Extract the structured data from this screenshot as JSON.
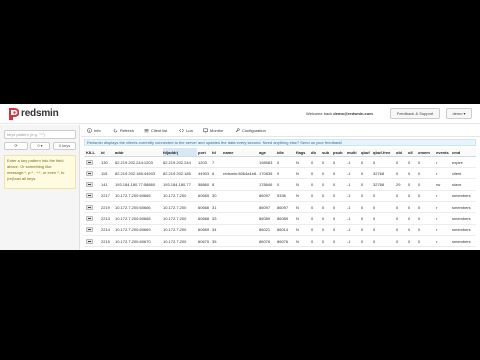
{
  "app": {
    "logo_text": "redsmin",
    "welcome_prefix": "Welcome back ",
    "welcome_email": "demo@redsmin.com",
    "feedback_label": "Feedback & Support",
    "user_label": "demo ▾"
  },
  "sidebar": {
    "search_placeholder": "keys pattern (e.g. \"*\")",
    "refresh_label": "⟳",
    "db_label": "0 ▾",
    "add_label": "0 keys",
    "hint_text": "Enter a key pattern into the field above. Or something like: message:*, p:* , *:*, or even *, to (re)load all keys."
  },
  "toolbar": {
    "items": [
      {
        "label": "Info",
        "icon": "info-icon"
      },
      {
        "label": "Refresh",
        "icon": "refresh-icon"
      },
      {
        "label": "Client list",
        "icon": "list-icon"
      },
      {
        "label": "Lua",
        "icon": "code-icon"
      },
      {
        "label": "Monitor",
        "icon": "monitor-icon"
      },
      {
        "label": "Configuration",
        "icon": "wrench-icon"
      }
    ],
    "alert": "Redsmin displays the clients currently connected to the server and updates the data every second. Need anything else? Send us your feedback!"
  },
  "table": {
    "columns": [
      "KILL",
      "id",
      "addr",
      "fd(addr)",
      "port",
      "fd",
      "name",
      "age",
      "idle",
      "flags",
      "db",
      "sub",
      "psub",
      "multi",
      "qbuf",
      "qbuf-free",
      "obl",
      "oll",
      "omem",
      "events",
      "cmd"
    ],
    "rows": [
      [
        "",
        "130",
        "82.219.202.244:1203",
        "82.219.202.244",
        "1203",
        "7",
        "",
        "198983",
        "0",
        "N",
        "0",
        "0",
        "0",
        "-1",
        "0",
        "0",
        "0",
        "0",
        "0",
        "r",
        "expire"
      ],
      [
        "",
        "115",
        "82.219.202.185:44903",
        "82.219.202.185",
        "44903",
        "6",
        "redsmin:8064a1b8...",
        "170835",
        "0",
        "N",
        "0",
        "0",
        "0",
        "-1",
        "0",
        "32768",
        "0",
        "0",
        "0",
        "r",
        "client"
      ],
      [
        "",
        "141",
        "193.184.180.77:58860",
        "193.184.180.77",
        "58860",
        "8",
        "",
        "178846",
        "0",
        "N",
        "0",
        "0",
        "0",
        "-1",
        "0",
        "32768",
        "29",
        "0",
        "0",
        "rw",
        "slave"
      ],
      [
        "",
        "2217",
        "10.172.7.200:60665",
        "10.172.7.200",
        "60665",
        "30",
        "",
        "86097",
        "5336",
        "N",
        "0",
        "0",
        "0",
        "-1",
        "0",
        "0",
        "0",
        "0",
        "0",
        "r",
        "smembers"
      ],
      [
        "",
        "2219",
        "10.172.7.200:60666",
        "10.172.7.200",
        "60666",
        "31",
        "",
        "86097",
        "86097",
        "N",
        "0",
        "0",
        "0",
        "-1",
        "0",
        "0",
        "0",
        "0",
        "0",
        "r",
        "smembers"
      ],
      [
        "",
        "2213",
        "10.172.7.200:60668",
        "10.172.7.200",
        "60668",
        "33",
        "",
        "86089",
        "86089",
        "N",
        "0",
        "0",
        "0",
        "-1",
        "0",
        "0",
        "0",
        "0",
        "0",
        "r",
        "smembers"
      ],
      [
        "",
        "2214",
        "10.172.7.200:60669",
        "10.172.7.200",
        "60669",
        "34",
        "",
        "86021",
        "86014",
        "N",
        "0",
        "0",
        "0",
        "-1",
        "0",
        "0",
        "0",
        "0",
        "0",
        "r",
        "smembers"
      ],
      [
        "",
        "2215",
        "10.172.7.200:60670",
        "10.172.7.200",
        "60670",
        "35",
        "",
        "86076",
        "86076",
        "N",
        "0",
        "0",
        "0",
        "-1",
        "0",
        "0",
        "0",
        "0",
        "0",
        "r",
        "smembers"
      ]
    ]
  },
  "colors": {
    "brand": "#d8323c",
    "alert_bg": "#e8f4fb",
    "hint_bg": "#fffbe0"
  }
}
